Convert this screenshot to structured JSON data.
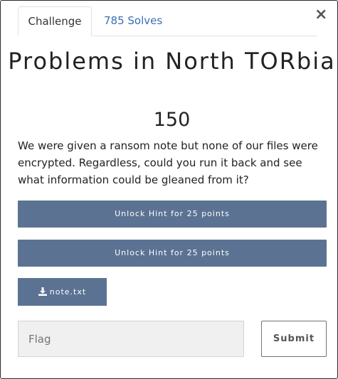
{
  "tabs": {
    "challenge_label": "Challenge",
    "solves_label": "785 Solves"
  },
  "close_label": "×",
  "challenge": {
    "title": "Problems in North TORbia",
    "points": "150",
    "description": "We were given a ransom note but none of our files were encrypted. Regardless, could you run it back and see what information could be gleaned from it?"
  },
  "hints": [
    {
      "label": "Unlock Hint for 25 points"
    },
    {
      "label": "Unlock Hint for 25 points"
    }
  ],
  "file": {
    "name": "note.txt",
    "icon": "download-icon"
  },
  "flag": {
    "placeholder": "Flag",
    "value": ""
  },
  "submit_label": "Submit",
  "colors": {
    "button_bg": "#5b7293",
    "tab_link": "#3a6fb0",
    "input_bg": "#f0f0f0"
  }
}
